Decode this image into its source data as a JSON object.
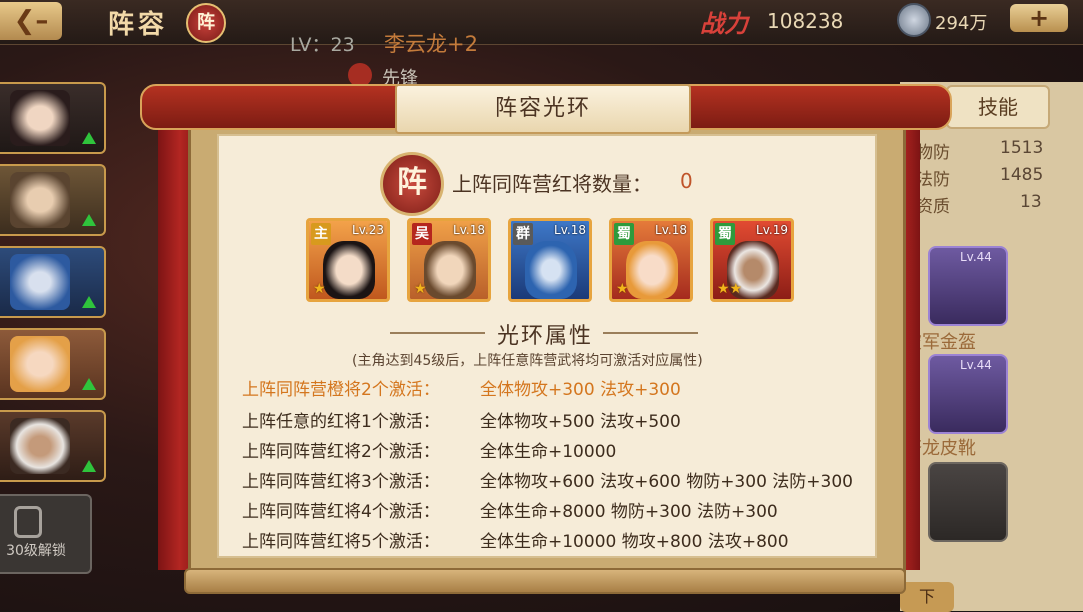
{
  "header": {
    "back_icon": "back-arrow-icon",
    "title": "阵容",
    "title_badge": "阵",
    "power_label": "战力",
    "power_value": "108238",
    "coin_value": "294万",
    "add_label": "+"
  },
  "hero_info": {
    "level": "LV：23",
    "name": "李云龙+2",
    "role": "先锋"
  },
  "side_list": {
    "lock_text": "30级解锁"
  },
  "right_panel": {
    "skill_tab": "技能",
    "stats": [
      {
        "label": "物防",
        "value": "1513"
      },
      {
        "label": "法防",
        "value": "1485"
      },
      {
        "label": "资质",
        "value": "13"
      }
    ],
    "equips": [
      {
        "level": "Lv.44",
        "name": "破军金盔"
      },
      {
        "level": "Lv.44",
        "name": "苍龙皮靴"
      }
    ],
    "bottom_button": "下"
  },
  "dialog": {
    "title": "阵容光环",
    "camp_badge": "阵",
    "count_label": "上阵同阵营红将数量：",
    "count_value": "0",
    "heroes": [
      {
        "tag": "主",
        "level": "Lv.23",
        "stars": "★"
      },
      {
        "tag": "吴",
        "level": "Lv.18",
        "stars": "★"
      },
      {
        "tag": "群",
        "level": "Lv.18",
        "stars": ""
      },
      {
        "tag": "蜀",
        "level": "Lv.18",
        "stars": "★"
      },
      {
        "tag": "蜀",
        "level": "Lv.19",
        "stars": "★★"
      }
    ],
    "aura_title": "光环属性",
    "aura_note": "(主角达到45级后，上阵任意阵营武将均可激活对应属性)",
    "bonuses": [
      {
        "condition": "上阵同阵营橙将2个激活：",
        "effect": "全体物攻+300 法攻+300"
      },
      {
        "condition": "上阵任意的红将1个激活：",
        "effect": "全体物攻+500 法攻+500"
      },
      {
        "condition": "上阵同阵营红将2个激活：",
        "effect": "全体生命+10000"
      },
      {
        "condition": "上阵同阵营红将3个激活：",
        "effect": "全体物攻+600 法攻+600 物防+300 法防+300"
      },
      {
        "condition": "上阵同阵营红将4个激活：",
        "effect": "全体生命+8000 物防+300 法防+300"
      },
      {
        "condition": "上阵同阵营红将5个激活：",
        "effect": "全体生命+10000 物攻+800 法攻+800"
      }
    ]
  }
}
